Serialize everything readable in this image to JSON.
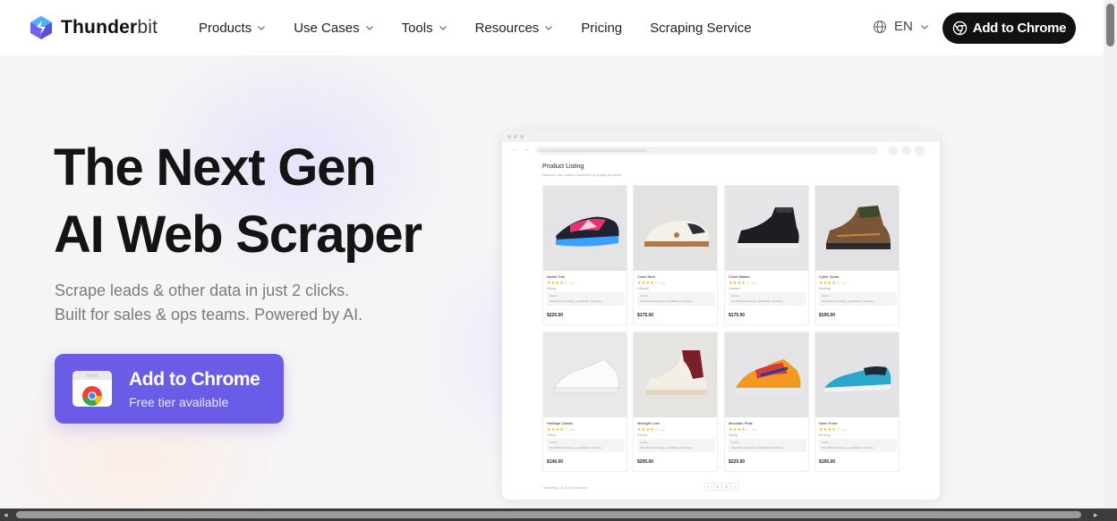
{
  "nav": {
    "brand_bold": "Thunder",
    "brand_light": "bit",
    "menu": [
      {
        "label": "Products",
        "dropdown": true
      },
      {
        "label": "Use Cases",
        "dropdown": true
      },
      {
        "label": "Tools",
        "dropdown": true
      },
      {
        "label": "Resources",
        "dropdown": true
      },
      {
        "label": "Pricing",
        "dropdown": false
      },
      {
        "label": "Scraping Service",
        "dropdown": false
      }
    ],
    "language": "EN",
    "cta_label": "Add to Chrome"
  },
  "hero": {
    "title_line1": "The Next Gen",
    "title_line2": "AI Web Scraper",
    "subtitle_line1": "Scrape leads & other data in just 2 clicks.",
    "subtitle_line2": "Built for sales & ops teams. Powered by AI.",
    "cta_label": "Add to Chrome",
    "cta_sub": "Free tier available"
  },
  "mock": {
    "title": "Product Listing",
    "description": "Discover our curated collection of quality products",
    "products": [
      {
        "name": "Alpine Trek",
        "category": "Hiking",
        "price": "$225.00",
        "rating": "4.8",
        "colors": "Colors",
        "variants": "Silver/Brown/Orange, Gray/Black, Tan/Navy"
      },
      {
        "name": "Cloud Nine",
        "category": "Lifestyle",
        "price": "$175.00",
        "rating": "4.6",
        "colors": "Colors",
        "variants": "Silver/Brown/Orange, Gray/Black, Tan/Navy"
      },
      {
        "name": "Cloud Walker",
        "category": "Lifestyle",
        "price": "$175.00",
        "rating": "4.5",
        "colors": "Colors",
        "variants": "Silver/Brown/Orange, Gray/Black, Tan/Navy"
      },
      {
        "name": "Cyber Sprint",
        "category": "Running",
        "price": "$195.00",
        "rating": "4.7",
        "colors": "Colors",
        "variants": "Silver/Brown/Orange, Gray/Black, Tan/Navy"
      },
      {
        "name": "Heritage Classic",
        "category": "Tennis",
        "price": "$145.00",
        "rating": "4.4",
        "colors": "Colors",
        "variants": "Silver/Brown/Orange, Gray/Black, Tan/Navy"
      },
      {
        "name": "Midnight Luxe",
        "category": "Formal",
        "price": "$295.00",
        "rating": "4.9",
        "colors": "Colors",
        "variants": "Silver/Brown/Orange, Gray/Black, Tan/Navy"
      },
      {
        "name": "Mountain Peak",
        "category": "Hiking",
        "price": "$225.00",
        "rating": "4.8",
        "colors": "Colors",
        "variants": "Silver/Brown/Orange, Gray/Black, Tan/Navy"
      },
      {
        "name": "Neon Pulse",
        "category": "Running",
        "price": "$195.00",
        "rating": "4.6",
        "colors": "Colors",
        "variants": "Silver/Brown/Orange, Gray/Black, Tan/Navy"
      }
    ],
    "footer": "Showing 1-8 of 16 products",
    "pages": [
      "‹",
      "1",
      "2",
      "›"
    ]
  },
  "colors": {
    "accent": "#6b5ce7",
    "dark": "#111111",
    "star": "#f1b21a"
  },
  "icons": [
    "thunderbit-logo-icon",
    "chevron-down-icon",
    "globe-icon",
    "chrome-icon",
    "star-icon"
  ]
}
